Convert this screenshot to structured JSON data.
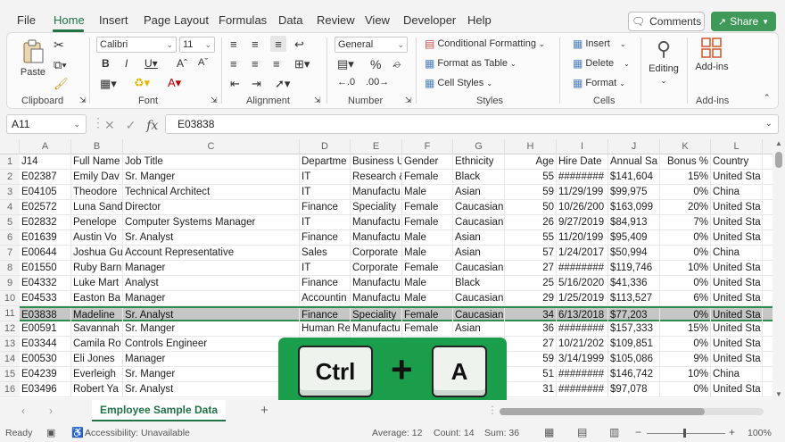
{
  "menu": {
    "tabs": [
      "File",
      "Home",
      "Insert",
      "Page Layout",
      "Formulas",
      "Data",
      "Review",
      "View",
      "Developer",
      "Help"
    ],
    "comments_label": "Comments",
    "share_label": "Share"
  },
  "ribbon": {
    "clipboard": {
      "paste_label": "Paste",
      "group_label": "Clipboard"
    },
    "font": {
      "font_name": "Calibri",
      "font_size": "11",
      "group_label": "Font"
    },
    "alignment": {
      "group_label": "Alignment"
    },
    "number": {
      "format": "General",
      "group_label": "Number"
    },
    "styles": {
      "conditional_formatting": "Conditional Formatting",
      "format_as_table": "Format as Table",
      "cell_styles": "Cell Styles",
      "group_label": "Styles"
    },
    "cells": {
      "insert": "Insert",
      "delete": "Delete",
      "format": "Format",
      "group_label": "Cells"
    },
    "editing": {
      "label": "Editing"
    },
    "addins": {
      "label": "Add-ins",
      "group_label": "Add-ins"
    }
  },
  "formula_bar": {
    "name_box": "A11",
    "fx_symbol": "fx",
    "formula": "E03838"
  },
  "columns": [
    "A",
    "B",
    "C",
    "D",
    "E",
    "F",
    "G",
    "H",
    "I",
    "J",
    "K",
    "L"
  ],
  "rows": [
    {
      "n": "1",
      "cells": [
        "J14",
        "Full Name",
        "Job Title",
        "Departme",
        "Business U",
        "Gender",
        "Ethnicity",
        "Age",
        "Hire Date",
        "Annual Sa",
        "Bonus %",
        "Country"
      ]
    },
    {
      "n": "2",
      "cells": [
        "E02387",
        "Emily Dav",
        "Sr. Manger",
        "IT",
        "Research &",
        "Female",
        "Black",
        "55",
        "########",
        "$141,604",
        "15%",
        "United Sta"
      ]
    },
    {
      "n": "3",
      "cells": [
        "E04105",
        "Theodore",
        "Technical Architect",
        "IT",
        "Manufactu",
        "Male",
        "Asian",
        "59",
        "11/29/199",
        "$99,975",
        "0%",
        "China"
      ]
    },
    {
      "n": "4",
      "cells": [
        "E02572",
        "Luna Sand",
        "Director",
        "Finance",
        "Speciality",
        "Female",
        "Caucasian",
        "50",
        "10/26/200",
        "$163,099",
        "20%",
        "United Sta"
      ]
    },
    {
      "n": "5",
      "cells": [
        "E02832",
        "Penelope",
        "Computer Systems Manager",
        "IT",
        "Manufactu",
        "Female",
        "Caucasian",
        "26",
        "9/27/2019",
        "$84,913",
        "7%",
        "United Sta"
      ]
    },
    {
      "n": "6",
      "cells": [
        "E01639",
        "Austin Vo",
        "Sr. Analyst",
        "Finance",
        "Manufactu",
        "Male",
        "Asian",
        "55",
        "11/20/199",
        "$95,409",
        "0%",
        "United Sta"
      ]
    },
    {
      "n": "7",
      "cells": [
        "E00644",
        "Joshua Gu",
        "Account Representative",
        "Sales",
        "Corporate",
        "Male",
        "Asian",
        "57",
        "1/24/2017",
        "$50,994",
        "0%",
        "China"
      ]
    },
    {
      "n": "8",
      "cells": [
        "E01550",
        "Ruby Barn",
        "Manager",
        "IT",
        "Corporate",
        "Female",
        "Caucasian",
        "27",
        "########",
        "$119,746",
        "10%",
        "United Sta"
      ]
    },
    {
      "n": "9",
      "cells": [
        "E04332",
        "Luke Mart",
        "Analyst",
        "Finance",
        "Manufactu",
        "Male",
        "Black",
        "25",
        "5/16/2020",
        "$41,336",
        "0%",
        "United Sta"
      ]
    },
    {
      "n": "10",
      "cells": [
        "E04533",
        "Easton Ba",
        "Manager",
        "Accountin",
        "Manufactu",
        "Male",
        "Caucasian",
        "29",
        "1/25/2019",
        "$113,527",
        "6%",
        "United Sta"
      ]
    },
    {
      "n": "11",
      "cells": [
        "E03838",
        "Madeline",
        "Sr. Analyst",
        "Finance",
        "Speciality",
        "Female",
        "Caucasian",
        "34",
        "6/13/2018",
        "$77,203",
        "0%",
        "United Sta"
      ]
    },
    {
      "n": "12",
      "cells": [
        "E00591",
        "Savannah",
        "Sr. Manger",
        "Human Re",
        "Manufactu",
        "Female",
        "Asian",
        "36",
        "########",
        "$157,333",
        "15%",
        "United Sta"
      ]
    },
    {
      "n": "13",
      "cells": [
        "E03344",
        "Camila Ro",
        "Controls Engineer",
        "",
        "",
        "",
        "",
        "27",
        "10/21/202",
        "$109,851",
        "0%",
        "United Sta"
      ]
    },
    {
      "n": "14",
      "cells": [
        "E00530",
        "Eli Jones",
        "Manager",
        "",
        "",
        "",
        "",
        "59",
        "3/14/1999",
        "$105,086",
        "9%",
        "United Sta"
      ]
    },
    {
      "n": "15",
      "cells": [
        "E04239",
        "Everleigh",
        "Sr. Manger",
        "",
        "",
        "",
        "",
        "51",
        "########",
        "$146,742",
        "10%",
        "China"
      ]
    },
    {
      "n": "16",
      "cells": [
        "E03496",
        "Robert Ya",
        "Sr. Analyst",
        "",
        "",
        "",
        "",
        "31",
        "########",
        "$97,078",
        "0%",
        "United Sta"
      ]
    }
  ],
  "selected_row": "11",
  "overlay": {
    "key1": "Ctrl",
    "plus": "+",
    "key2": "A"
  },
  "sheet_tab": "Employee Sample Data",
  "add_sheet": "+",
  "status": {
    "ready": "Ready",
    "accessibility": "Accessibility: Unavailable",
    "average": "Average: 12",
    "count": "Count: 14",
    "sum": "Sum: 36",
    "zoom": "100%"
  },
  "colors": {
    "accent": "#217346",
    "share_bg": "#3f9a5a",
    "overlay_bg": "#1b9e4b",
    "selection_border": "#2d8b4e"
  }
}
